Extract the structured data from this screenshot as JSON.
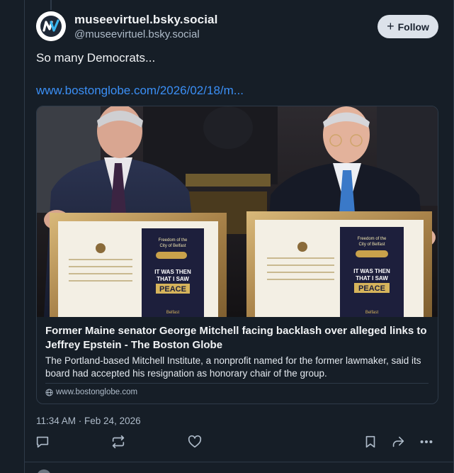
{
  "post": {
    "display_name": "museevirtuel.bsky.social",
    "handle": "@museevirtuel.bsky.social",
    "follow_label": "Follow",
    "text": "So many Democrats...",
    "link_text": "www.bostonglobe.com/2026/02/18/m...",
    "timestamp": "11:34 AM · Feb 24, 2026"
  },
  "card": {
    "title": "Former Maine senator George Mitchell facing backlash over alleged links to Jeffrey Epstein - The Boston Globe",
    "description": "The Portland-based Mitchell Institute, a nonprofit named for the former lawmaker, said its board had accepted his resignation as honorary chair of the group.",
    "domain": "www.bostonglobe.com",
    "certificate_text": [
      "Freedom of the",
      "City of Belfast",
      "IT WAS THEN",
      "THAT I SAW",
      "PEACE",
      "Belfast"
    ]
  },
  "icons": {
    "avatar": "nv-logo",
    "reply": "speech-bubble-icon",
    "repost": "repost-arrows-icon",
    "like": "heart-icon",
    "bookmark": "bookmark-icon",
    "share": "share-arrow-icon",
    "more": "more-dots-icon",
    "domain": "globe-icon"
  },
  "colors": {
    "background": "#161e27",
    "link": "#3b8ff5",
    "muted": "#aebbc9",
    "follow_bg": "#dce2ea"
  }
}
